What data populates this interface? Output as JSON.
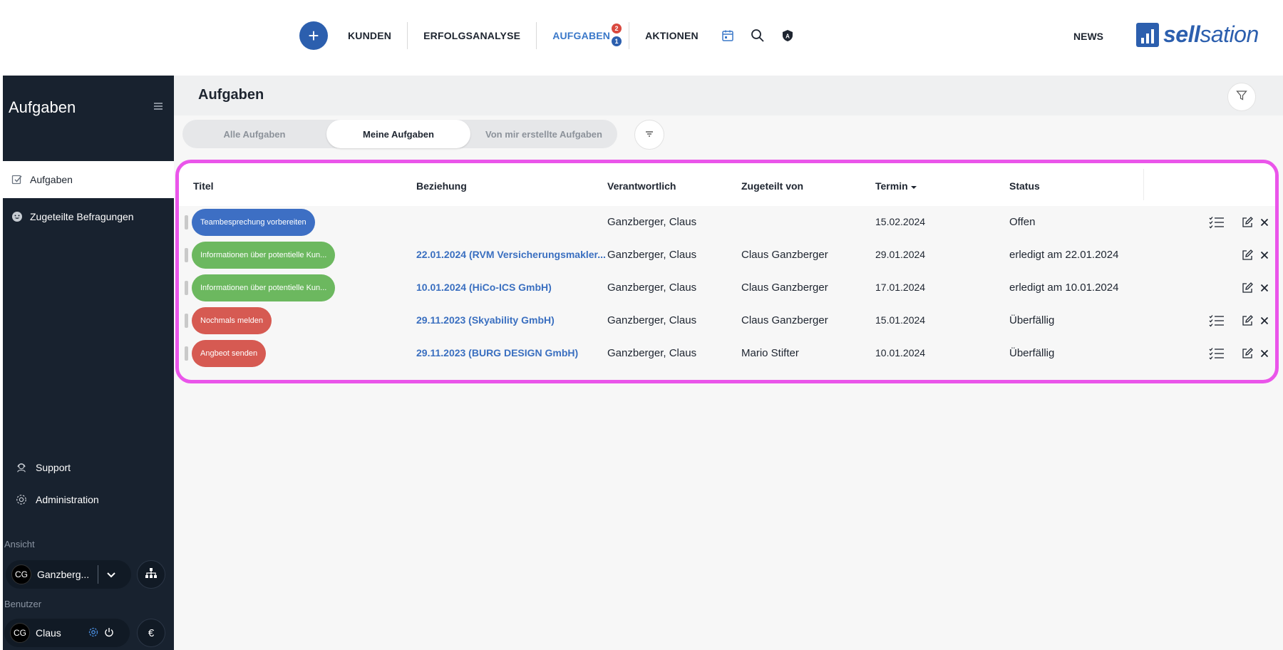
{
  "nav": {
    "plus": "+",
    "kunden": "KUNDEN",
    "erfolgsanalyse": "ERFOLGSANALYSE",
    "aufgaben": "AUFGABEN",
    "aufgaben_badge_red": "2",
    "aufgaben_badge_blue": "1",
    "aktionen": "AKTIONEN",
    "news": "NEWS",
    "logo_bold": "sell",
    "logo_rest": "sation"
  },
  "sidebar": {
    "title": "Aufgaben",
    "items": [
      {
        "label": "Aufgaben"
      },
      {
        "label": "Zugeteilte Befragungen"
      },
      {
        "label": "Support"
      },
      {
        "label": "Administration"
      }
    ],
    "ansicht_label": "Ansicht",
    "ansicht_initials": "CG",
    "ansicht_name": "Ganzberg...",
    "benutzer_label": "Benutzer",
    "benutzer_initials": "CG",
    "benutzer_name": "Claus",
    "currency": "€"
  },
  "main": {
    "title": "Aufgaben",
    "tabs": [
      "Alle Aufgaben",
      "Meine Aufgaben",
      "Von mir erstellte Aufgaben"
    ],
    "active_tab": "Meine Aufgaben"
  },
  "table": {
    "columns": [
      "Titel",
      "Beziehung",
      "Verantwortlich",
      "Zugeteilt von",
      "Termin",
      "Status"
    ],
    "rows": [
      {
        "title": "Teambesprechung vorbereiten",
        "title_color": "#3d6fc4",
        "beziehung": "",
        "verantwortlich": "Ganzberger, Claus",
        "zugeteilt": "",
        "termin": "15.02.2024",
        "status": "Offen",
        "checklist": true
      },
      {
        "title": "Informationen über potentielle Kun...",
        "title_color": "#6cb85f",
        "beziehung": "22.01.2024 (RVM Versicherungsmakler...",
        "verantwortlich": "Ganzberger, Claus",
        "zugeteilt": "Claus Ganzberger",
        "termin": "29.01.2024",
        "status": "erledigt am 22.01.2024",
        "checklist": false
      },
      {
        "title": "Informationen über potentielle Kun...",
        "title_color": "#6cb85f",
        "beziehung": "10.01.2024 (HiCo-ICS GmbH)",
        "verantwortlich": "Ganzberger, Claus",
        "zugeteilt": "Claus Ganzberger",
        "termin": "17.01.2024",
        "status": "erledigt am 10.01.2024",
        "checklist": false
      },
      {
        "title": "Nochmals melden",
        "title_color": "#d65a52",
        "beziehung": "29.11.2023 (Skyability GmbH)",
        "verantwortlich": "Ganzberger, Claus",
        "zugeteilt": "Claus Ganzberger",
        "termin": "15.01.2024",
        "status": "Überfällig",
        "checklist": true
      },
      {
        "title": "Angbeot senden",
        "title_color": "#d65a52",
        "beziehung": "29.11.2023 (BURG DESIGN GmbH)",
        "verantwortlich": "Ganzberger, Claus",
        "zugeteilt": "Mario Stifter",
        "termin": "10.01.2024",
        "status": "Überfällig",
        "checklist": true
      }
    ]
  },
  "icons": {
    "calendar": "calendar-icon",
    "search": "search-icon",
    "shield": "shield-icon",
    "filter": "filter-icon",
    "sort": "sort-icon",
    "edit": "edit-icon",
    "close": "close-icon",
    "checklist": "checklist-icon"
  },
  "colors": {
    "accent": "#2c5fae",
    "link": "#3a6fc0",
    "sidebar_bg": "#18222f",
    "highlight_border": "#ea55ea"
  }
}
